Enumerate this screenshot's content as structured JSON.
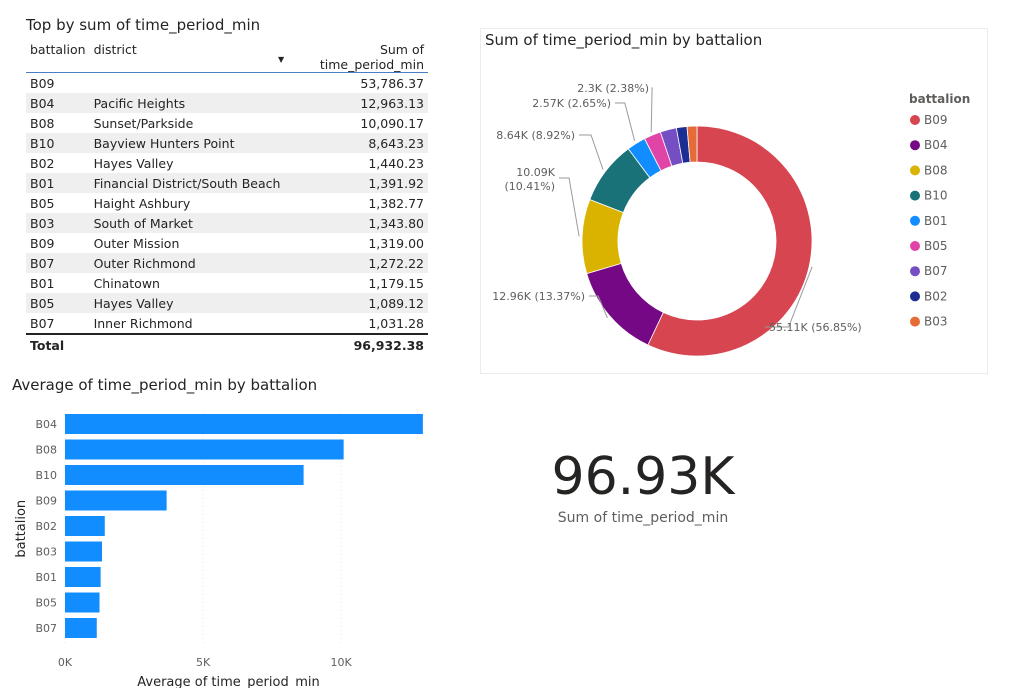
{
  "table": {
    "title": "Top by sum of time_period_min",
    "columns": [
      "battalion",
      "district",
      "Sum of time_period_min"
    ],
    "rows": [
      [
        "B09",
        "",
        "53,786.37"
      ],
      [
        "B04",
        "Pacific Heights",
        "12,963.13"
      ],
      [
        "B08",
        "Sunset/Parkside",
        "10,090.17"
      ],
      [
        "B10",
        "Bayview Hunters Point",
        "8,643.23"
      ],
      [
        "B02",
        "Hayes Valley",
        "1,440.23"
      ],
      [
        "B01",
        "Financial District/South Beach",
        "1,391.92"
      ],
      [
        "B05",
        "Haight Ashbury",
        "1,382.77"
      ],
      [
        "B03",
        "South of Market",
        "1,343.80"
      ],
      [
        "B09",
        "Outer Mission",
        "1,319.00"
      ],
      [
        "B07",
        "Outer Richmond",
        "1,272.22"
      ],
      [
        "B01",
        "Chinatown",
        "1,179.15"
      ],
      [
        "B05",
        "Hayes Valley",
        "1,089.12"
      ],
      [
        "B07",
        "Inner Richmond",
        "1,031.28"
      ]
    ],
    "total_label": "Total",
    "total_value": "96,932.38",
    "sort_indicator": "sort-descending-icon"
  },
  "card": {
    "value": "96.93K",
    "label": "Sum of time_period_min"
  },
  "chart_data": [
    {
      "type": "pie",
      "title": "Sum of time_period_min by battalion",
      "legend_title": "battalion",
      "legend_position": "right",
      "categories": [
        "B09",
        "B04",
        "B08",
        "B10",
        "B01",
        "B05",
        "B07",
        "B02",
        "B03"
      ],
      "values": [
        55110,
        12960,
        10090,
        8640,
        2570,
        2300,
        2200,
        1440,
        1340
      ],
      "colors": [
        "#d64550",
        "#750985",
        "#d9b300",
        "#197278",
        "#118dff",
        "#e044a7",
        "#744ec2",
        "#1c2d93",
        "#e66c37"
      ],
      "data_labels": [
        {
          "category": "B09",
          "text": "55.11K (56.85%)"
        },
        {
          "category": "B04",
          "text": "12.96K (13.37%)"
        },
        {
          "category": "B08",
          "text": "10.09K (10.41%)"
        },
        {
          "category": "B10",
          "text": "8.64K (8.92%)"
        },
        {
          "category": "B01",
          "text": "2.57K (2.65%)"
        },
        {
          "category": "B05",
          "text": "2.3K (2.38%)"
        }
      ]
    },
    {
      "type": "bar",
      "orientation": "horizontal",
      "title": "Average of time_period_min by battalion",
      "xlabel": "Average of time_period_min",
      "ylabel": "battalion",
      "categories": [
        "B04",
        "B08",
        "B10",
        "B09",
        "B02",
        "B03",
        "B01",
        "B05",
        "B07"
      ],
      "values": [
        12960,
        10090,
        8640,
        3680,
        1440,
        1340,
        1290,
        1250,
        1150
      ],
      "xlim": [
        0,
        13000
      ],
      "xticks": [
        0,
        5000,
        10000
      ],
      "xtick_labels": [
        "0K",
        "5K",
        "10K"
      ],
      "bar_color": "#118dff",
      "grid": true
    }
  ]
}
